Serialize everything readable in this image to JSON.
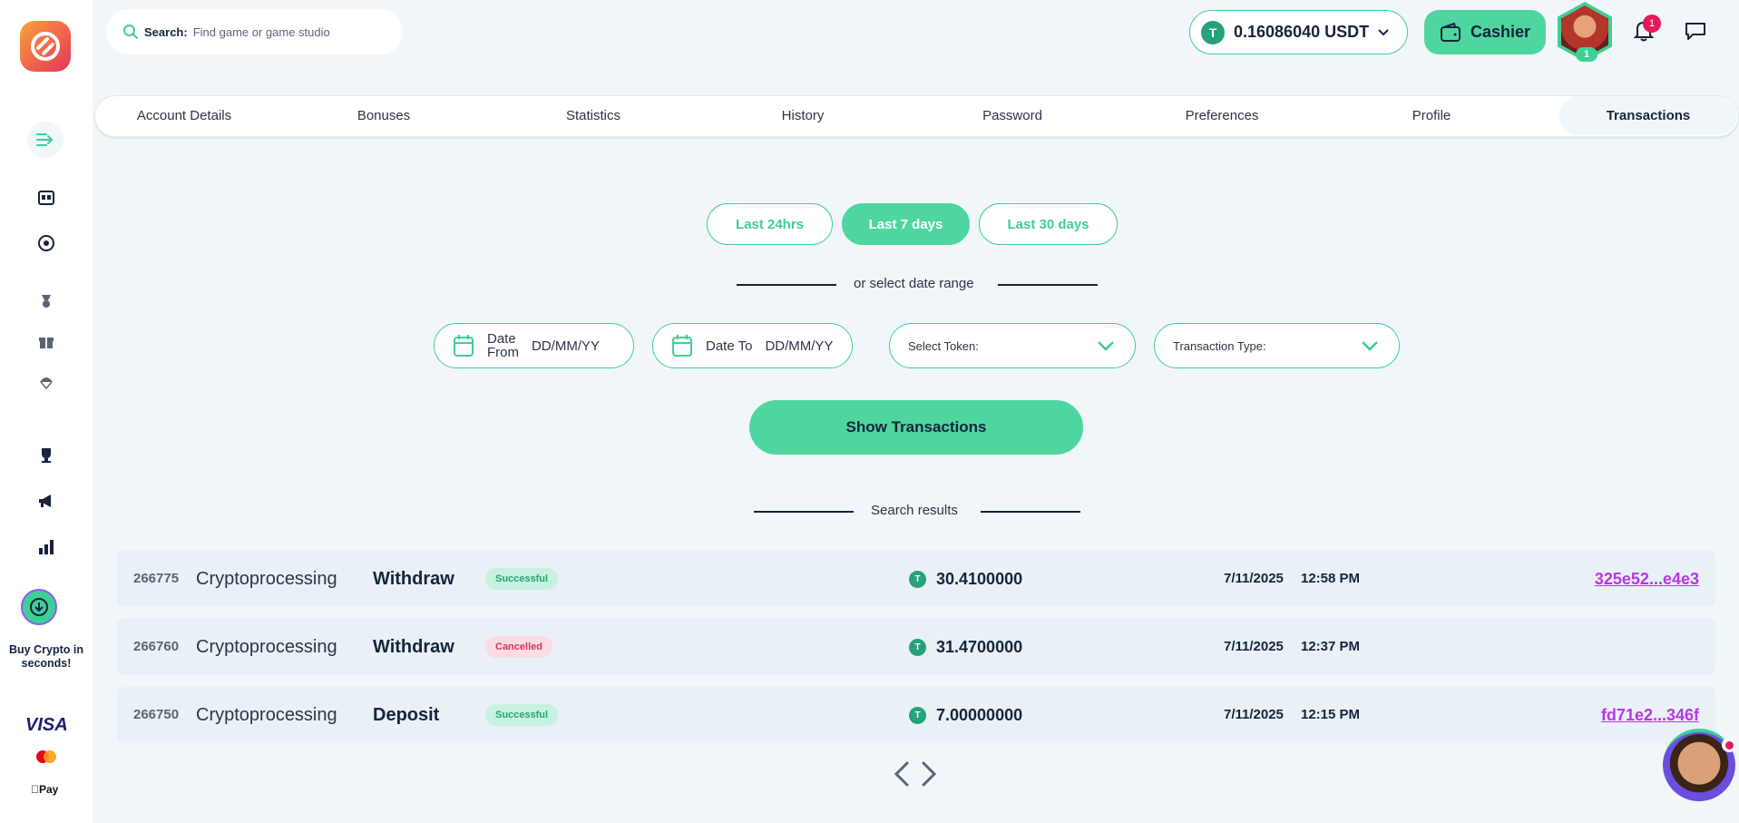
{
  "search": {
    "label": "Search:",
    "placeholder": "Find game or game studio"
  },
  "wallet": {
    "balance": "0.16086040 USDT",
    "token_symbol": "T"
  },
  "cashier": {
    "label": "Cashier"
  },
  "user": {
    "level": "1",
    "notifications": "1"
  },
  "tabs": [
    {
      "label": "Account Details"
    },
    {
      "label": "Bonuses"
    },
    {
      "label": "Statistics"
    },
    {
      "label": "History"
    },
    {
      "label": "Password"
    },
    {
      "label": "Preferences"
    },
    {
      "label": "Profile"
    },
    {
      "label": "Transactions",
      "active": true
    }
  ],
  "filters": {
    "ranges": [
      {
        "label": "Last 24hrs"
      },
      {
        "label": "Last 7 days",
        "active": true
      },
      {
        "label": "Last 30 days"
      }
    ],
    "or_text": "or select date range",
    "date_from": {
      "label_line1": "Date",
      "label_line2": "From",
      "placeholder": "DD/MM/YY"
    },
    "date_to": {
      "label": "Date To",
      "placeholder": "DD/MM/YY"
    },
    "select_token": "Select Token:",
    "transaction_type": "Transaction Type:",
    "show_button": "Show Transactions"
  },
  "results": {
    "heading": "Search results",
    "rows": [
      {
        "id": "266775",
        "processor": "Cryptoprocessing",
        "type": "Withdraw",
        "status": "Successful",
        "coin": "T",
        "amount": "30.4100000",
        "date": "7/11/2025",
        "time": "12:58 PM",
        "hash": "325e52...e4e3"
      },
      {
        "id": "266760",
        "processor": "Cryptoprocessing",
        "type": "Withdraw",
        "status": "Cancelled",
        "coin": "T",
        "amount": "31.4700000",
        "date": "7/11/2025",
        "time": "12:37 PM",
        "hash": ""
      },
      {
        "id": "266750",
        "processor": "Cryptoprocessing",
        "type": "Deposit",
        "status": "Successful",
        "coin": "T",
        "amount": "7.00000000",
        "date": "7/11/2025",
        "time": "12:15 PM",
        "hash": "fd71e2...346f"
      }
    ]
  },
  "sidebar": {
    "buy_crypto": "Buy Crypto in seconds!",
    "visa": "VISA",
    "applepay": "Pay"
  },
  "colors": {
    "accent": "#4fd69f",
    "accent_border": "#3ecf95",
    "background": "#f1f6fa",
    "text": "#15243c",
    "link": "#b936e8",
    "success": "#25a56f",
    "cancel": "#d6335f"
  }
}
